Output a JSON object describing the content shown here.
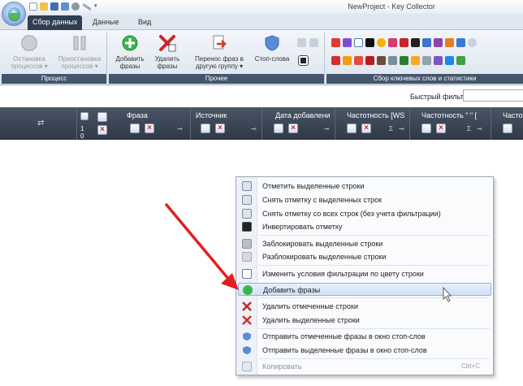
{
  "window": {
    "title": "NewProject - Key Collector"
  },
  "ribbon_tabs": [
    {
      "label": "Сбор данных",
      "active": true
    },
    {
      "label": "Данные",
      "active": false
    },
    {
      "label": "Вид",
      "active": false
    }
  ],
  "ribbon": {
    "groups": {
      "process": {
        "caption": "Процесс",
        "stop_label": "Остановка\nпроцессов ▾",
        "pause_label": "Приостановка\nпроцессов ▾"
      },
      "other": {
        "caption": "Прочее",
        "add_label": "Добавить\nфразы",
        "delete_label": "Удалить\nфразы",
        "move_label": "Перенос фраз в\nдругую группу ▾",
        "stopwords_label": "Стоп-слова"
      },
      "collect": {
        "caption": "Сбор ключевых слов и статистики"
      }
    }
  },
  "filter": {
    "label": "Быстрый фильтр:",
    "value": ""
  },
  "grid": {
    "columns": [
      {
        "title": "Фраза"
      },
      {
        "title": "Источник"
      },
      {
        "title": "Дата добавлени"
      },
      {
        "title": "Частотность [WS"
      },
      {
        "title": "Частотность \" \" ["
      },
      {
        "title": "Частотн"
      }
    ],
    "funnel_glyph": "⊸",
    "sigma_glyph": "Σ",
    "count_glyph": "1 0"
  },
  "context_menu": {
    "items": [
      {
        "label": "Отметить выделенные строки",
        "icon": "check-row-icon"
      },
      {
        "label": "Снять отметку с выделенных строк",
        "icon": "uncheck-row-icon"
      },
      {
        "label": "Снять отметку со всех строк (без учета фильтрации)",
        "icon": "uncheck-all-icon"
      },
      {
        "label": "Инвертировать отметку",
        "icon": "invert-icon"
      },
      {
        "label": "Заблокировать выделенные строки",
        "icon": "lock-icon"
      },
      {
        "label": "Разблокировать выделенные строки",
        "icon": "unlock-icon"
      },
      {
        "label": "Изменить условия фильтрации по цвету строки",
        "icon": "filter-color-icon"
      },
      {
        "label": "Добавить фразы",
        "icon": "add-icon",
        "highlighted": true
      },
      {
        "label": "Удалить отмеченные строки",
        "icon": "delete-checked-icon"
      },
      {
        "label": "Удалить выделенные строки",
        "icon": "delete-icon"
      },
      {
        "label": "Отправить отмеченные фразы в окно стоп-слов",
        "icon": "shield-icon"
      },
      {
        "label": "Отправить выделенные фразы в окно стоп-слов",
        "icon": "shield-icon"
      },
      {
        "label": "Копировать",
        "icon": "copy-icon",
        "shortcut": "Ctrl+C",
        "disabled": true
      }
    ]
  },
  "colors": {
    "accent": "#2f3e52",
    "highlight": "#cfe0f6",
    "arrow": "#e02020"
  }
}
